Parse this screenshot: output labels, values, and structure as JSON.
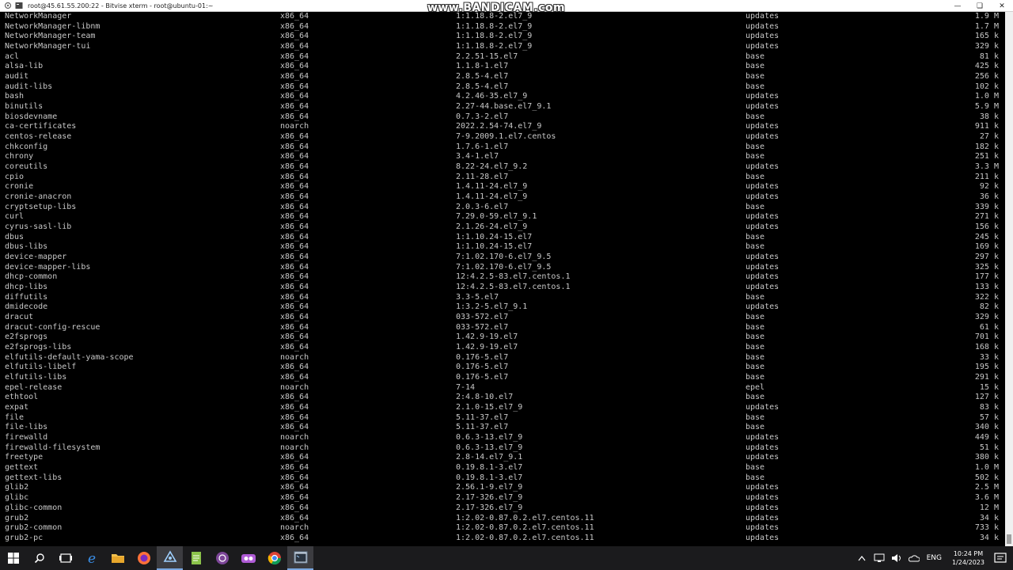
{
  "window": {
    "title": "root@45.61.55.200:22 - Bitvise xterm - root@ubuntu-01:~",
    "watermark": "www.BANDICAM.com"
  },
  "packages": [
    {
      "name": "NetworkManager",
      "arch": "x86_64",
      "version": "1:1.18.8-2.el7_9",
      "repo": "updates",
      "size": "1.9 M"
    },
    {
      "name": "NetworkManager-libnm",
      "arch": "x86_64",
      "version": "1:1.18.8-2.el7_9",
      "repo": "updates",
      "size": "1.7 M"
    },
    {
      "name": "NetworkManager-team",
      "arch": "x86_64",
      "version": "1:1.18.8-2.el7_9",
      "repo": "updates",
      "size": "165 k"
    },
    {
      "name": "NetworkManager-tui",
      "arch": "x86_64",
      "version": "1:1.18.8-2.el7_9",
      "repo": "updates",
      "size": "329 k"
    },
    {
      "name": "acl",
      "arch": "x86_64",
      "version": "2.2.51-15.el7",
      "repo": "base",
      "size": "81 k"
    },
    {
      "name": "alsa-lib",
      "arch": "x86_64",
      "version": "1.1.8-1.el7",
      "repo": "base",
      "size": "425 k"
    },
    {
      "name": "audit",
      "arch": "x86_64",
      "version": "2.8.5-4.el7",
      "repo": "base",
      "size": "256 k"
    },
    {
      "name": "audit-libs",
      "arch": "x86_64",
      "version": "2.8.5-4.el7",
      "repo": "base",
      "size": "102 k"
    },
    {
      "name": "bash",
      "arch": "x86_64",
      "version": "4.2.46-35.el7_9",
      "repo": "updates",
      "size": "1.0 M"
    },
    {
      "name": "binutils",
      "arch": "x86_64",
      "version": "2.27-44.base.el7_9.1",
      "repo": "updates",
      "size": "5.9 M"
    },
    {
      "name": "biosdevname",
      "arch": "x86_64",
      "version": "0.7.3-2.el7",
      "repo": "base",
      "size": "38 k"
    },
    {
      "name": "ca-certificates",
      "arch": "noarch",
      "version": "2022.2.54-74.el7_9",
      "repo": "updates",
      "size": "911 k"
    },
    {
      "name": "centos-release",
      "arch": "x86_64",
      "version": "7-9.2009.1.el7.centos",
      "repo": "updates",
      "size": "27 k"
    },
    {
      "name": "chkconfig",
      "arch": "x86_64",
      "version": "1.7.6-1.el7",
      "repo": "base",
      "size": "182 k"
    },
    {
      "name": "chrony",
      "arch": "x86_64",
      "version": "3.4-1.el7",
      "repo": "base",
      "size": "251 k"
    },
    {
      "name": "coreutils",
      "arch": "x86_64",
      "version": "8.22-24.el7_9.2",
      "repo": "updates",
      "size": "3.3 M"
    },
    {
      "name": "cpio",
      "arch": "x86_64",
      "version": "2.11-28.el7",
      "repo": "base",
      "size": "211 k"
    },
    {
      "name": "cronie",
      "arch": "x86_64",
      "version": "1.4.11-24.el7_9",
      "repo": "updates",
      "size": "92 k"
    },
    {
      "name": "cronie-anacron",
      "arch": "x86_64",
      "version": "1.4.11-24.el7_9",
      "repo": "updates",
      "size": "36 k"
    },
    {
      "name": "cryptsetup-libs",
      "arch": "x86_64",
      "version": "2.0.3-6.el7",
      "repo": "base",
      "size": "339 k"
    },
    {
      "name": "curl",
      "arch": "x86_64",
      "version": "7.29.0-59.el7_9.1",
      "repo": "updates",
      "size": "271 k"
    },
    {
      "name": "cyrus-sasl-lib",
      "arch": "x86_64",
      "version": "2.1.26-24.el7_9",
      "repo": "updates",
      "size": "156 k"
    },
    {
      "name": "dbus",
      "arch": "x86_64",
      "version": "1:1.10.24-15.el7",
      "repo": "base",
      "size": "245 k"
    },
    {
      "name": "dbus-libs",
      "arch": "x86_64",
      "version": "1:1.10.24-15.el7",
      "repo": "base",
      "size": "169 k"
    },
    {
      "name": "device-mapper",
      "arch": "x86_64",
      "version": "7:1.02.170-6.el7_9.5",
      "repo": "updates",
      "size": "297 k"
    },
    {
      "name": "device-mapper-libs",
      "arch": "x86_64",
      "version": "7:1.02.170-6.el7_9.5",
      "repo": "updates",
      "size": "325 k"
    },
    {
      "name": "dhcp-common",
      "arch": "x86_64",
      "version": "12:4.2.5-83.el7.centos.1",
      "repo": "updates",
      "size": "177 k"
    },
    {
      "name": "dhcp-libs",
      "arch": "x86_64",
      "version": "12:4.2.5-83.el7.centos.1",
      "repo": "updates",
      "size": "133 k"
    },
    {
      "name": "diffutils",
      "arch": "x86_64",
      "version": "3.3-5.el7",
      "repo": "base",
      "size": "322 k"
    },
    {
      "name": "dmidecode",
      "arch": "x86_64",
      "version": "1:3.2-5.el7_9.1",
      "repo": "updates",
      "size": "82 k"
    },
    {
      "name": "dracut",
      "arch": "x86_64",
      "version": "033-572.el7",
      "repo": "base",
      "size": "329 k"
    },
    {
      "name": "dracut-config-rescue",
      "arch": "x86_64",
      "version": "033-572.el7",
      "repo": "base",
      "size": "61 k"
    },
    {
      "name": "e2fsprogs",
      "arch": "x86_64",
      "version": "1.42.9-19.el7",
      "repo": "base",
      "size": "701 k"
    },
    {
      "name": "e2fsprogs-libs",
      "arch": "x86_64",
      "version": "1.42.9-19.el7",
      "repo": "base",
      "size": "168 k"
    },
    {
      "name": "elfutils-default-yama-scope",
      "arch": "noarch",
      "version": "0.176-5.el7",
      "repo": "base",
      "size": "33 k"
    },
    {
      "name": "elfutils-libelf",
      "arch": "x86_64",
      "version": "0.176-5.el7",
      "repo": "base",
      "size": "195 k"
    },
    {
      "name": "elfutils-libs",
      "arch": "x86_64",
      "version": "0.176-5.el7",
      "repo": "base",
      "size": "291 k"
    },
    {
      "name": "epel-release",
      "arch": "noarch",
      "version": "7-14",
      "repo": "epel",
      "size": "15 k"
    },
    {
      "name": "ethtool",
      "arch": "x86_64",
      "version": "2:4.8-10.el7",
      "repo": "base",
      "size": "127 k"
    },
    {
      "name": "expat",
      "arch": "x86_64",
      "version": "2.1.0-15.el7_9",
      "repo": "updates",
      "size": "83 k"
    },
    {
      "name": "file",
      "arch": "x86_64",
      "version": "5.11-37.el7",
      "repo": "base",
      "size": "57 k"
    },
    {
      "name": "file-libs",
      "arch": "x86_64",
      "version": "5.11-37.el7",
      "repo": "base",
      "size": "340 k"
    },
    {
      "name": "firewalld",
      "arch": "noarch",
      "version": "0.6.3-13.el7_9",
      "repo": "updates",
      "size": "449 k"
    },
    {
      "name": "firewalld-filesystem",
      "arch": "noarch",
      "version": "0.6.3-13.el7_9",
      "repo": "updates",
      "size": "51 k"
    },
    {
      "name": "freetype",
      "arch": "x86_64",
      "version": "2.8-14.el7_9.1",
      "repo": "updates",
      "size": "380 k"
    },
    {
      "name": "gettext",
      "arch": "x86_64",
      "version": "0.19.8.1-3.el7",
      "repo": "base",
      "size": "1.0 M"
    },
    {
      "name": "gettext-libs",
      "arch": "x86_64",
      "version": "0.19.8.1-3.el7",
      "repo": "base",
      "size": "502 k"
    },
    {
      "name": "glib2",
      "arch": "x86_64",
      "version": "2.56.1-9.el7_9",
      "repo": "updates",
      "size": "2.5 M"
    },
    {
      "name": "glibc",
      "arch": "x86_64",
      "version": "2.17-326.el7_9",
      "repo": "updates",
      "size": "3.6 M"
    },
    {
      "name": "glibc-common",
      "arch": "x86_64",
      "version": "2.17-326.el7_9",
      "repo": "updates",
      "size": "12 M"
    },
    {
      "name": "grub2",
      "arch": "x86_64",
      "version": "1:2.02-0.87.0.2.el7.centos.11",
      "repo": "updates",
      "size": "34 k"
    },
    {
      "name": "grub2-common",
      "arch": "noarch",
      "version": "1:2.02-0.87.0.2.el7.centos.11",
      "repo": "updates",
      "size": "733 k"
    },
    {
      "name": "grub2-pc",
      "arch": "x86_64",
      "version": "1:2.02-0.87.0.2.el7.centos.11",
      "repo": "updates",
      "size": "34 k"
    }
  ],
  "taskbar": {
    "apps": [
      {
        "icon": "windows-start-icon"
      },
      {
        "icon": "search-icon"
      },
      {
        "icon": "task-view-icon"
      },
      {
        "icon": "edge-icon"
      },
      {
        "icon": "file-explorer-icon"
      },
      {
        "icon": "firefox-icon"
      },
      {
        "icon": "bitvise-client-icon"
      },
      {
        "icon": "notepad-plus-icon"
      },
      {
        "icon": "tor-browser-icon"
      },
      {
        "icon": "bandicam-icon"
      },
      {
        "icon": "chrome-icon"
      },
      {
        "icon": "terminal-icon"
      }
    ],
    "tray": {
      "language": "ENG",
      "time": "10:24 PM",
      "date": "1/24/2023"
    }
  },
  "colors": {
    "terminal_bg": "#000000",
    "terminal_fg": "#c8c8c8",
    "taskbar_bg": "#1b1b1d",
    "titlebar_bg": "#ffffff"
  }
}
